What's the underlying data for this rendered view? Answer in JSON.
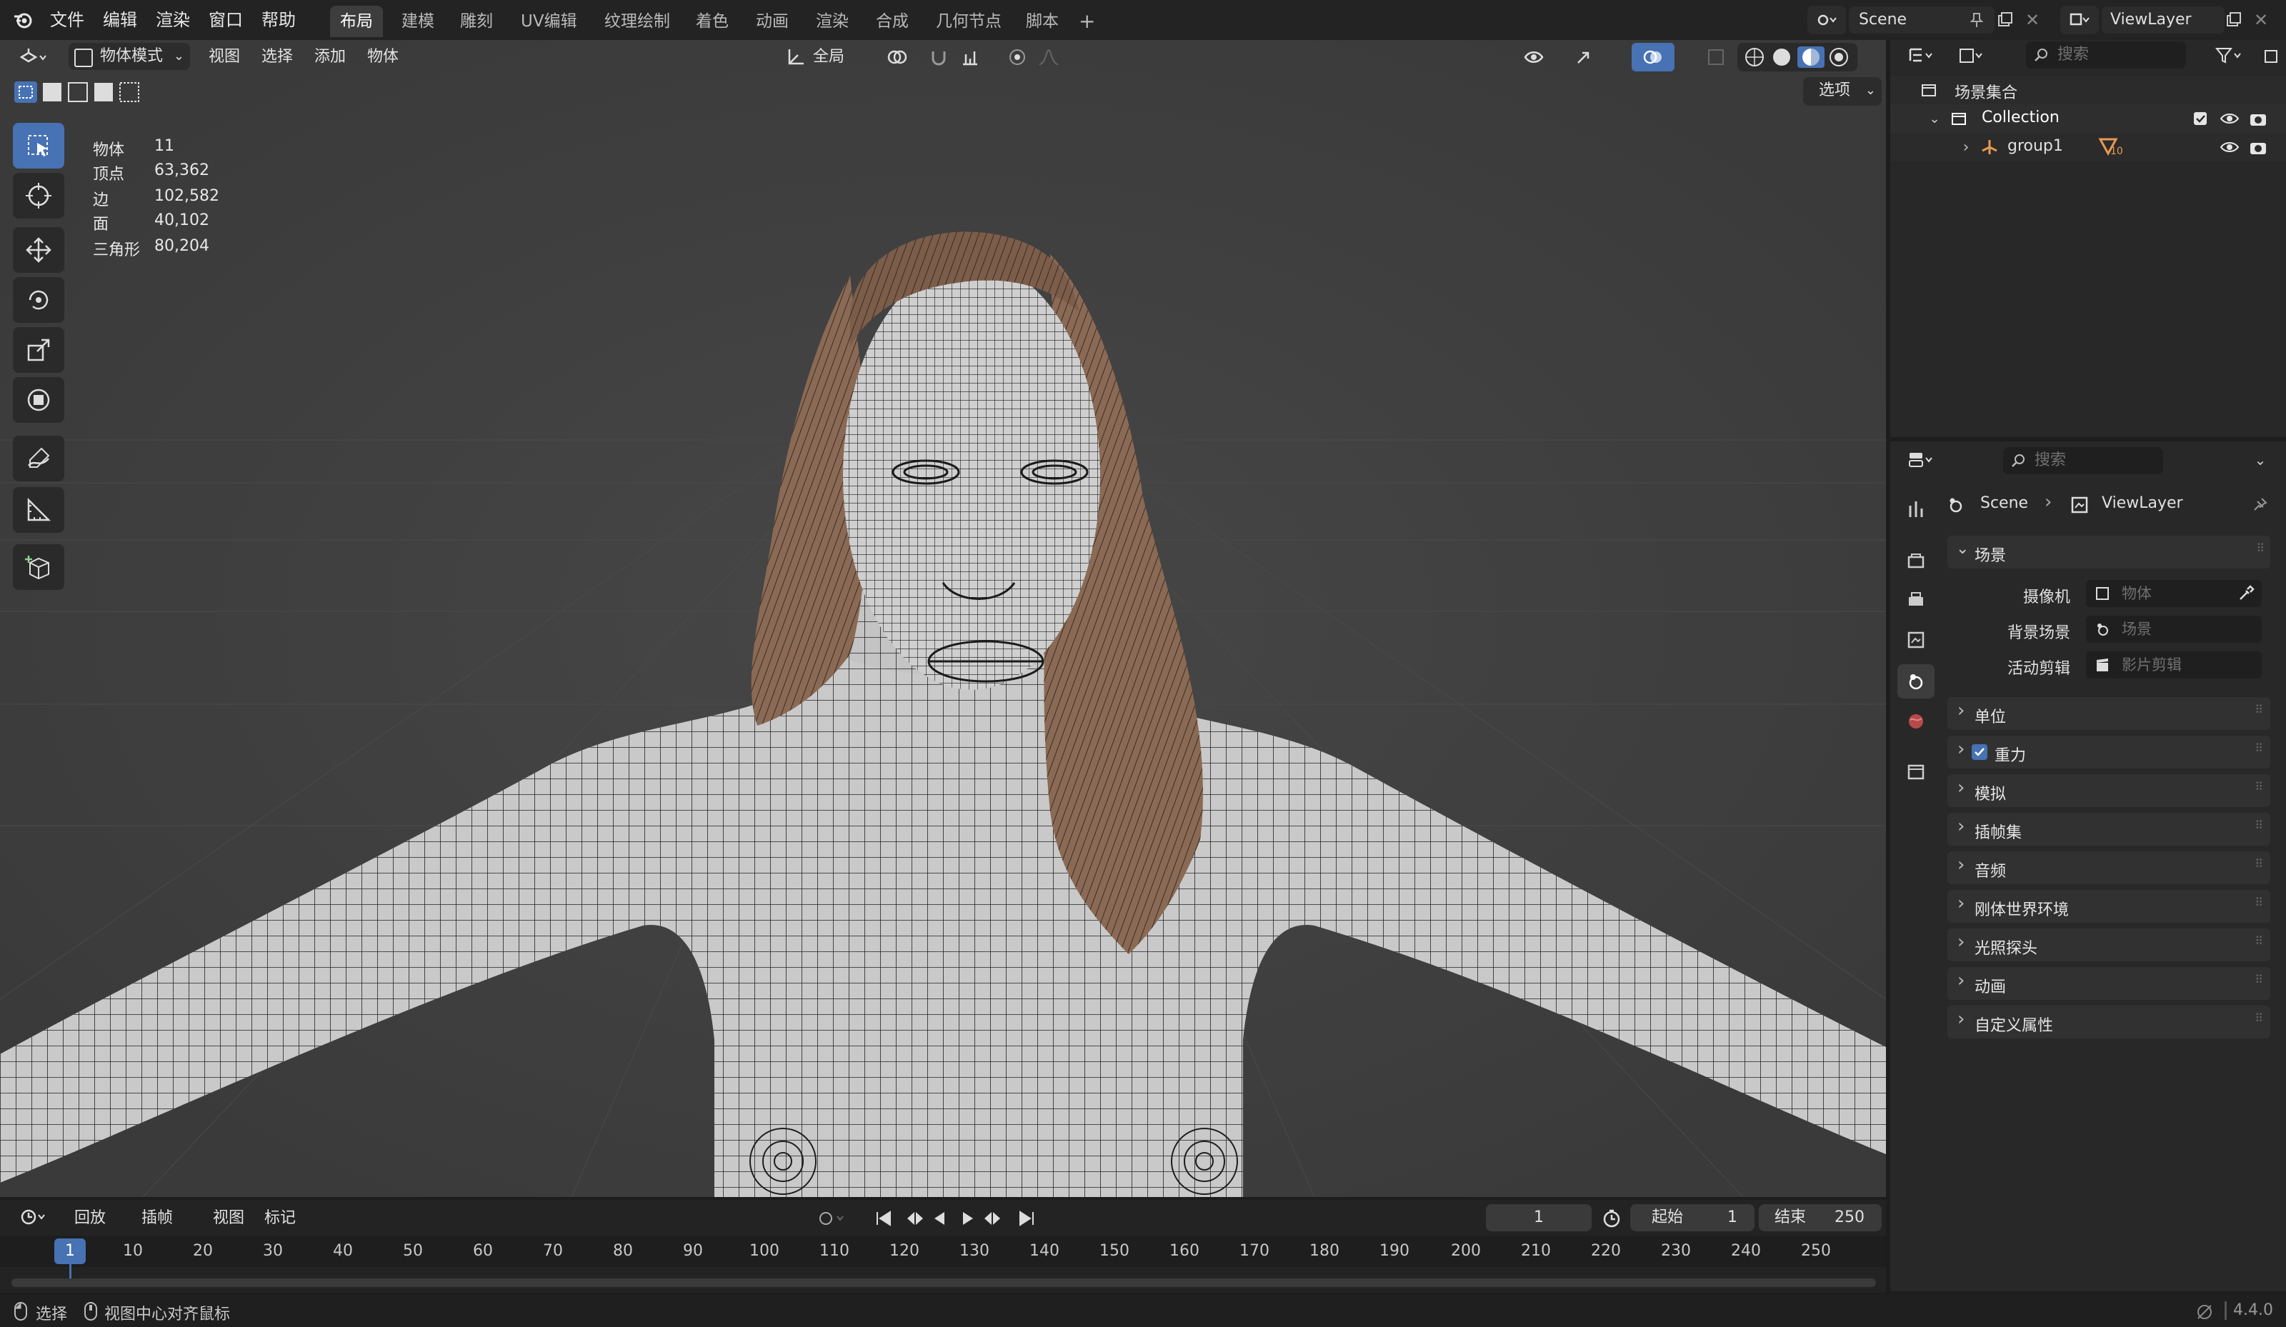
{
  "top_menu": {
    "file": "文件",
    "edit": "编辑",
    "render": "渲染",
    "window": "窗口",
    "help": "帮助"
  },
  "workspaces": [
    "布局",
    "建模",
    "雕刻",
    "UV编辑",
    "纹理绘制",
    "着色",
    "动画",
    "渲染",
    "合成",
    "几何节点",
    "脚本"
  ],
  "active_workspace": "布局",
  "add_tab": "+",
  "scene_name": "Scene",
  "view_layer": "ViewLayer",
  "viewport": {
    "mode": "物体模式",
    "menus": [
      "视图",
      "选择",
      "添加",
      "物体"
    ],
    "transform_orientation": "全局",
    "options_label": "选项",
    "stats": [
      {
        "key": "物体",
        "value": "11"
      },
      {
        "key": "顶点",
        "value": "63,362"
      },
      {
        "key": "边",
        "value": "102,582"
      },
      {
        "key": "面",
        "value": "40,102"
      },
      {
        "key": "三角形",
        "value": "80,204"
      }
    ]
  },
  "outliner": {
    "search_placeholder": "搜索",
    "scene_collection": "场景集合",
    "collection": "Collection",
    "item": "group1",
    "item_badge": "10"
  },
  "properties": {
    "search_placeholder": "搜索",
    "breadcrumb_scene": "Scene",
    "breadcrumb_layer": "ViewLayer",
    "scene_section": "场景",
    "camera_label": "摄像机",
    "camera_placeholder": "物体",
    "bg_scene_label": "背景场景",
    "bg_scene_placeholder": "场景",
    "clip_label": "活动剪辑",
    "clip_placeholder": "影片剪辑",
    "sections": [
      "单位",
      "重力",
      "模拟",
      "插帧集",
      "音频",
      "刚体世界环境",
      "光照探头",
      "动画",
      "自定义属性"
    ],
    "gravity_checked": true
  },
  "timeline": {
    "menus": [
      "回放",
      "插帧",
      "视图",
      "标记"
    ],
    "current_frame": "1",
    "start_label": "起始",
    "start_value": "1",
    "end_label": "结束",
    "end_value": "250",
    "ticks": [
      "1",
      "10",
      "20",
      "30",
      "40",
      "50",
      "60",
      "70",
      "80",
      "90",
      "100",
      "110",
      "120",
      "130",
      "140",
      "150",
      "160",
      "170",
      "180",
      "190",
      "200",
      "210",
      "220",
      "230",
      "240",
      "250"
    ]
  },
  "status": {
    "select": "选择",
    "center_view": "视图中心对齐鼠标",
    "version": "4.4.0"
  },
  "colors": {
    "accent": "#4772b3",
    "viewport_bg": "#3d3d3d",
    "panel_bg": "#282828",
    "hair": "#8a6a55"
  }
}
